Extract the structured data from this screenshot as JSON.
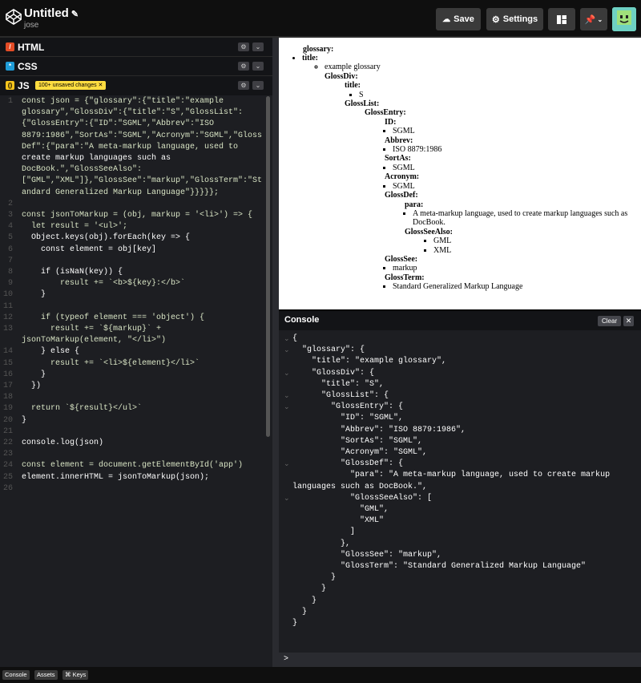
{
  "header": {
    "title": "Untitled",
    "user": "jose",
    "save_label": "Save",
    "settings_label": "Settings"
  },
  "editors": {
    "html_label": "HTML",
    "css_label": "CSS",
    "js_label": "JS",
    "unsaved_badge": "100+ unsaved changes ✕"
  },
  "code_lines": [
    {
      "n": "1",
      "t": "const json = {\"glossary\":{\"title\":\"example"
    },
    {
      "n": "",
      "t": "glossary\",\"GlossDiv\":{\"title\":\"S\",\"GlossList\":"
    },
    {
      "n": "",
      "t": "{\"GlossEntry\":{\"ID\":\"SGML\",\"Abbrev\":\"ISO"
    },
    {
      "n": "",
      "t": "8879:1986\",\"SortAs\":\"SGML\",\"Acronym\":\"SGML\",\"Gloss"
    },
    {
      "n": "",
      "t": "Def\":{\"para\":\"A meta-markup language, used to"
    },
    {
      "n": "",
      "t": "create markup languages such as"
    },
    {
      "n": "",
      "t": "DocBook.\",\"GlossSeeAlso\":"
    },
    {
      "n": "",
      "t": "[\"GML\",\"XML\"]},\"GlossSee\":\"markup\",\"GlossTerm\":\"St"
    },
    {
      "n": "",
      "t": "andard Generalized Markup Language\"}}}}};"
    },
    {
      "n": "2",
      "t": ""
    },
    {
      "n": "3",
      "t": "const jsonToMarkup = (obj, markup = '<li>') => {"
    },
    {
      "n": "4",
      "t": "  let result = '<ul>';"
    },
    {
      "n": "5",
      "t": "  Object.keys(obj).forEach(key => {"
    },
    {
      "n": "6",
      "t": "    const element = obj[key]"
    },
    {
      "n": "7",
      "t": ""
    },
    {
      "n": "8",
      "t": "    if (isNaN(key)) {"
    },
    {
      "n": "9",
      "t": "        result += `<b>${key}:</b>`"
    },
    {
      "n": "10",
      "t": "    }"
    },
    {
      "n": "11",
      "t": ""
    },
    {
      "n": "12",
      "t": "    if (typeof element === 'object') {"
    },
    {
      "n": "13",
      "t": "      result += `${markup}` +"
    },
    {
      "n": "",
      "t": "jsonToMarkup(element, \"</li>\")"
    },
    {
      "n": "14",
      "t": "    } else {"
    },
    {
      "n": "15",
      "t": "      result += `<li>${element}</li>`"
    },
    {
      "n": "16",
      "t": "    }"
    },
    {
      "n": "17",
      "t": "  })"
    },
    {
      "n": "18",
      "t": ""
    },
    {
      "n": "19",
      "t": "  return `${result}</ul>`"
    },
    {
      "n": "20",
      "t": "}"
    },
    {
      "n": "21",
      "t": ""
    },
    {
      "n": "22",
      "t": "console.log(json)"
    },
    {
      "n": "23",
      "t": ""
    },
    {
      "n": "24",
      "t": "const element = document.getElementById('app')"
    },
    {
      "n": "25",
      "t": "element.innerHTML = jsonToMarkup(json);"
    },
    {
      "n": "26",
      "t": ""
    }
  ],
  "preview": {
    "glossary": "glossary:",
    "title_label": "title:",
    "title_value": "example glossary",
    "glossdiv": "GlossDiv:",
    "div_title_label": "title:",
    "div_title_value": "S",
    "glosslist": "GlossList:",
    "glossentry": "GlossEntry:",
    "id_label": "ID:",
    "id_value": "SGML",
    "abbrev_label": "Abbrev:",
    "abbrev_value": "ISO 8879:1986",
    "sortas_label": "SortAs:",
    "sortas_value": "SGML",
    "acronym_label": "Acronym:",
    "acronym_value": "SGML",
    "glossdef_label": "GlossDef:",
    "para_label": "para:",
    "para_value": "A meta-markup language, used to create markup languages such as DocBook.",
    "seealso_label": "GlossSeeAlso:",
    "seealso_1": "GML",
    "seealso_2": "XML",
    "glosssee_label": "GlossSee:",
    "glosssee_value": "markup",
    "glossterm_label": "GlossTerm:",
    "glossterm_value": "Standard Generalized Markup Language"
  },
  "console": {
    "label": "Console",
    "clear_label": "Clear",
    "close_label": "✕",
    "prompt": ">",
    "lines": [
      {
        "i": 0,
        "t": "{"
      },
      {
        "i": 0,
        "t": "  \"glossary\": {"
      },
      {
        "i": 0,
        "t": "    \"title\": \"example glossary\","
      },
      {
        "i": 0,
        "t": "    \"GlossDiv\": {"
      },
      {
        "i": 0,
        "t": "      \"title\": \"S\","
      },
      {
        "i": 0,
        "t": "      \"GlossList\": {"
      },
      {
        "i": 0,
        "t": "        \"GlossEntry\": {"
      },
      {
        "i": 0,
        "t": "          \"ID\": \"SGML\","
      },
      {
        "i": 0,
        "t": "          \"Abbrev\": \"ISO 8879:1986\","
      },
      {
        "i": 0,
        "t": "          \"SortAs\": \"SGML\","
      },
      {
        "i": 0,
        "t": "          \"Acronym\": \"SGML\","
      },
      {
        "i": 0,
        "t": "          \"GlossDef\": {"
      },
      {
        "i": 0,
        "t": "            \"para\": \"A meta-markup language, used to create markup"
      },
      {
        "i": 0,
        "t": "languages such as DocBook.\","
      },
      {
        "i": 0,
        "t": "            \"GlossSeeAlso\": ["
      },
      {
        "i": 0,
        "t": "              \"GML\","
      },
      {
        "i": 0,
        "t": "              \"XML\""
      },
      {
        "i": 0,
        "t": "            ]"
      },
      {
        "i": 0,
        "t": "          },"
      },
      {
        "i": 0,
        "t": "          \"GlossSee\": \"markup\","
      },
      {
        "i": 0,
        "t": "          \"GlossTerm\": \"Standard Generalized Markup Language\""
      },
      {
        "i": 0,
        "t": "        }"
      },
      {
        "i": 0,
        "t": "      }"
      },
      {
        "i": 0,
        "t": "    }"
      },
      {
        "i": 0,
        "t": "  }"
      },
      {
        "i": 0,
        "t": "}"
      }
    ]
  },
  "footer": {
    "console_label": "Console",
    "assets_label": "Assets",
    "keys_label": "⌘ Keys"
  }
}
